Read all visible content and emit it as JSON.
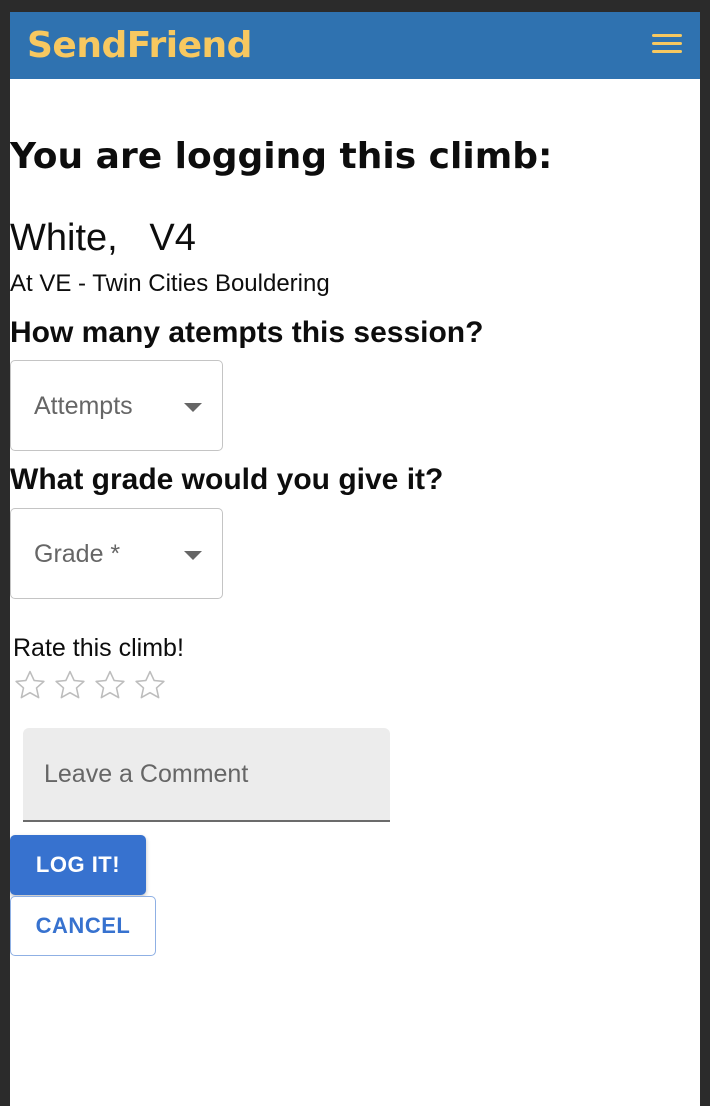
{
  "app": {
    "brand": "SendFriend",
    "menu_icon": "hamburger-menu-icon"
  },
  "page": {
    "heading": "You are logging this climb:",
    "climb_color": "White,",
    "climb_grade": "V4",
    "gym": "At VE - Twin Cities Bouldering"
  },
  "attempts": {
    "question": "How many atempts this session?",
    "select_label": "Attempts"
  },
  "grade": {
    "question": "What grade would you give it?",
    "select_label": "Grade *"
  },
  "rating": {
    "label": "Rate this climb!",
    "max_stars": 4,
    "value": 0
  },
  "comment": {
    "placeholder": "Leave a Comment"
  },
  "actions": {
    "log_label": "LOG IT!",
    "cancel_label": "CANCEL"
  },
  "colors": {
    "navbar": "#2f72b0",
    "brand": "#f7c860",
    "primary": "#3772cf"
  }
}
